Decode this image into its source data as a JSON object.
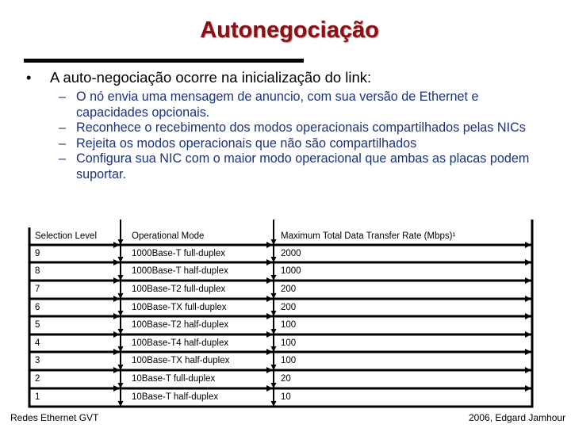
{
  "slide": {
    "title": "Autonegociação",
    "bullet": {
      "marker": "•",
      "text": "A auto-negociação ocorre na inicialização do link:"
    },
    "sub_bullets": [
      {
        "marker": "–",
        "text": "O nó envia uma mensagem de anuncio, com sua versão de Ethernet e capacidades opcionais."
      },
      {
        "marker": "–",
        "text": "Reconhece o recebimento dos modos operacionais compartilhados pelas NICs"
      },
      {
        "marker": "–",
        "text": "Rejeita os modos operacionais que não são compartilhados"
      },
      {
        "marker": "–",
        "text": "Configura sua NIC com o maior modo operacional que ambas as placas podem suportar."
      }
    ],
    "table": {
      "headers": [
        "Selection Level",
        "Operational Mode",
        "Maximum Total Data Transfer Rate (Mbps)¹"
      ],
      "rows": [
        [
          "9",
          "1000Base-T full-duplex",
          "2000"
        ],
        [
          "8",
          "1000Base-T half-duplex",
          "1000"
        ],
        [
          "7",
          "100Base-T2 full-duplex",
          "200"
        ],
        [
          "6",
          "100Base-TX full-duplex",
          "200"
        ],
        [
          "5",
          "100Base-T2 half-duplex",
          "100"
        ],
        [
          "4",
          "100Base-T4 half-duplex",
          "100"
        ],
        [
          "3",
          "100Base-TX half-duplex",
          "100"
        ],
        [
          "2",
          "10Base-T full-duplex",
          "20"
        ],
        [
          "1",
          "10Base-T half-duplex",
          "10"
        ]
      ]
    },
    "footer": {
      "left": "Redes Ethernet GVT",
      "right": "2006, Edgard Jamhour"
    },
    "colors": {
      "title": "#8b0f14",
      "sub_bullet_text": "#1a3180"
    }
  }
}
